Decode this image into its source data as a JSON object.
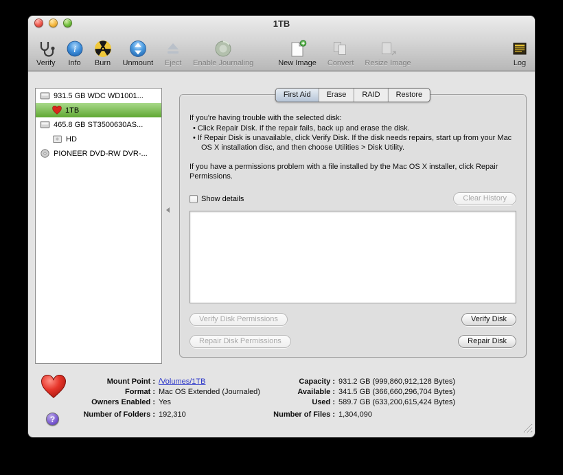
{
  "window": {
    "title": "1TB"
  },
  "toolbar": {
    "items": [
      {
        "label": "Verify"
      },
      {
        "label": "Info"
      },
      {
        "label": "Burn"
      },
      {
        "label": "Unmount"
      },
      {
        "label": "Eject"
      },
      {
        "label": "Enable Journaling"
      },
      {
        "label": "New Image"
      },
      {
        "label": "Convert"
      },
      {
        "label": "Resize Image"
      },
      {
        "label": "Log"
      }
    ]
  },
  "sidebar": {
    "items": [
      {
        "label": "931.5 GB WDC WD1001..."
      },
      {
        "label": "1TB"
      },
      {
        "label": "465.8 GB ST3500630AS..."
      },
      {
        "label": "HD"
      },
      {
        "label": "PIONEER DVD-RW DVR-..."
      }
    ]
  },
  "tabs": [
    {
      "label": "First Aid"
    },
    {
      "label": "Erase"
    },
    {
      "label": "RAID"
    },
    {
      "label": "Restore"
    }
  ],
  "first_aid": {
    "intro": "If you're having trouble with the selected disk:",
    "bullet1": "• Click Repair Disk. If the repair fails, back up and erase the disk.",
    "bullet2": "• If Repair Disk is unavailable, click Verify Disk. If the disk needs repairs, start up from your Mac OS X installation disc, and then choose Utilities > Disk Utility.",
    "note": "If you have a permissions problem with a file installed by the Mac OS X installer, click Repair Permissions.",
    "show_details": "Show details",
    "clear_history": "Clear History",
    "verify_permissions": "Verify Disk Permissions",
    "verify_disk": "Verify Disk",
    "repair_permissions": "Repair Disk Permissions",
    "repair_disk": "Repair Disk"
  },
  "info": {
    "left": [
      {
        "label": "Mount Point :",
        "value": "/Volumes/1TB"
      },
      {
        "label": "Format :",
        "value": "Mac OS Extended (Journaled)"
      },
      {
        "label": "Owners Enabled :",
        "value": "Yes"
      },
      {
        "label": "Number of Folders :",
        "value": "192,310"
      }
    ],
    "right": [
      {
        "label": "Capacity :",
        "value": "931.2 GB (999,860,912,128 Bytes)"
      },
      {
        "label": "Available :",
        "value": "341.5 GB (366,660,296,704 Bytes)"
      },
      {
        "label": "Used :",
        "value": "589.7 GB (633,200,615,424 Bytes)"
      },
      {
        "label": "Number of Files :",
        "value": "1,304,090"
      }
    ]
  },
  "help": {
    "label": "?"
  },
  "colors": {
    "selection_green": "#5fa832",
    "link_blue": "#2a35c9",
    "selected_tab": "#b6c5d7"
  }
}
